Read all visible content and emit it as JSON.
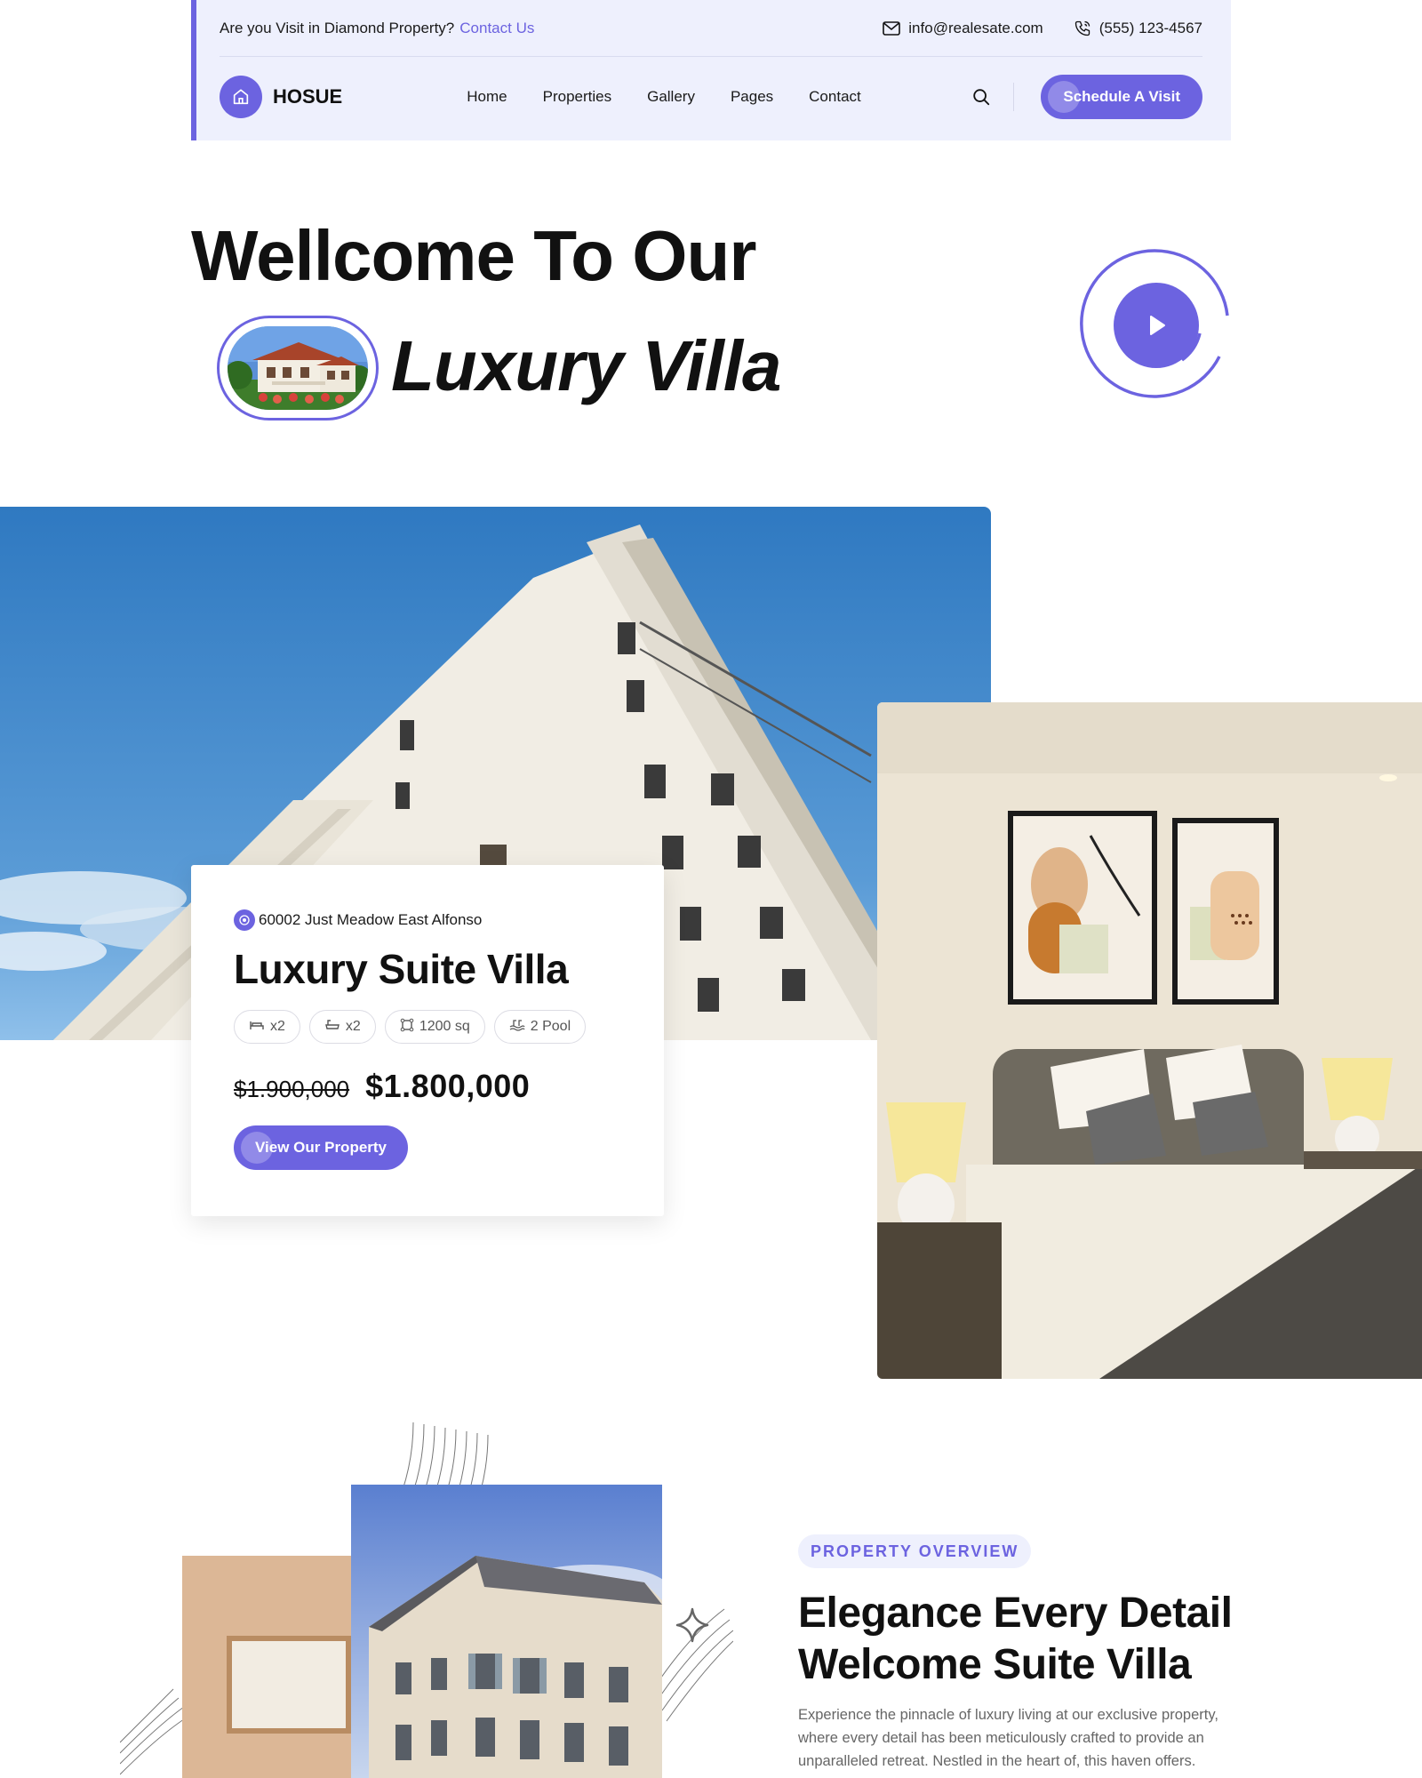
{
  "topbar": {
    "question": "Are you Visit in Diamond Property?",
    "contact_link": "Contact Us",
    "email": "info@realesate.com",
    "phone": "(555) 123-4567"
  },
  "header": {
    "logo_text": "HOSUE",
    "nav": [
      "Home",
      "Properties",
      "Gallery",
      "Pages",
      "Contact"
    ],
    "cta_label": "Schedule A Visit"
  },
  "hero": {
    "line1": "Wellcome To Our",
    "line2": "Luxury Villa"
  },
  "property_card": {
    "address": "60002 Just Meadow East Alfonso",
    "title": "Luxury Suite Villa",
    "features": [
      {
        "icon": "bed-icon",
        "label": "x2"
      },
      {
        "icon": "bathtub-icon",
        "label": "x2"
      },
      {
        "icon": "area-icon",
        "label": "1200 sq"
      },
      {
        "icon": "pool-icon",
        "label": "2 Pool"
      }
    ],
    "old_price": "$1.900,000",
    "new_price": "$1.800,000",
    "button_label": "View Our Property"
  },
  "overview": {
    "badge": "PROPERTY OVERVIEW",
    "title_line1": "Elegance Every Detail",
    "title_line2": "Welcome Suite Villa",
    "text": "Experience the pinnacle of luxury living at our exclusive property, where every detail has been meticulously crafted to provide an unparalleled retreat. Nestled in the heart of, this haven offers."
  },
  "colors": {
    "accent": "#6c63e0",
    "header_bg": "#eef0fd",
    "text": "#111111",
    "muted": "#666666"
  }
}
